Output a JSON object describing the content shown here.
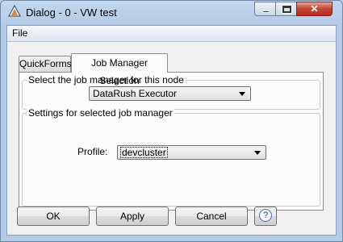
{
  "window": {
    "title": "Dialog - 0 - VW test",
    "icon": "knime-triangle-icon",
    "controls": {
      "minimize": "minimize-icon",
      "maximize": "maximize-icon",
      "close": "✕"
    }
  },
  "menu": {
    "file": "File"
  },
  "tabs": [
    {
      "label": "QuickForms",
      "selected": false
    },
    {
      "label": "Job Manager Selection",
      "selected": true
    }
  ],
  "panel": {
    "group1": {
      "title": "Select the job manager for this node",
      "selected": "DataRush Executor"
    },
    "group2": {
      "title": "Settings for selected job manager",
      "profile_label": "Profile:",
      "profile_value": "devcluster"
    }
  },
  "buttons": {
    "ok": "OK",
    "apply": "Apply",
    "cancel": "Cancel",
    "help": "?"
  },
  "colors": {
    "close_button": "#c7493a",
    "frame": "#b9d1ea"
  }
}
